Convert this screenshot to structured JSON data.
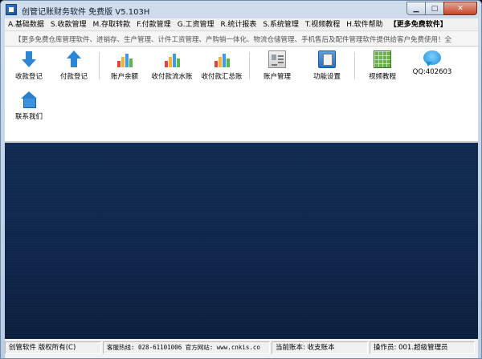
{
  "window": {
    "title": "创管记账财务软件 免费版  V5.103H"
  },
  "window_buttons": {
    "minimize": "▁",
    "maximize": "□",
    "close": "✕"
  },
  "menu": [
    {
      "label": "A.基础数据"
    },
    {
      "label": "S.收款管理"
    },
    {
      "label": "M.存取转款"
    },
    {
      "label": "F.付款管理"
    },
    {
      "label": "G.工资管理"
    },
    {
      "label": "R.统计报表"
    },
    {
      "label": "S.系统管理"
    },
    {
      "label": "T.视频教程"
    },
    {
      "label": "H.软件帮助"
    },
    {
      "label": "【更多免费软件】"
    }
  ],
  "marquee": {
    "text": "【更多免费仓库管理软件、进销存、生产管理、计件工资管理、产购销一体化、物流仓储管理、手机售后及配件管理软件提供给客户免费使用！全"
  },
  "toolbar": {
    "row1": [
      {
        "label": "收款登记",
        "icon": "arrow-down-icon"
      },
      {
        "label": "付款登记",
        "icon": "arrow-up-icon"
      },
      {
        "label": "账户余额",
        "icon": "bar-chart-icon"
      },
      {
        "label": "收付款流水账",
        "icon": "bar-chart-icon"
      },
      {
        "label": "收付款汇总账",
        "icon": "bar-chart-icon"
      },
      {
        "label": "账户管理",
        "icon": "account-doc-icon"
      },
      {
        "label": "功能设置",
        "icon": "settings-doc-icon"
      },
      {
        "label": "视频教程",
        "icon": "spreadsheet-icon"
      },
      {
        "label": "QQ:402603",
        "icon": "chat-bubble-icon"
      }
    ],
    "row2": [
      {
        "label": "联系我们",
        "icon": "home-icon"
      }
    ]
  },
  "colors": {
    "accent": "#2b86d6",
    "workspace": "#112a52",
    "close_button": "#c6452b"
  },
  "statusbar": {
    "copyright": "创管软件  版权所有(C)",
    "hotline": "客服热线: 028-61101006  官方网站: www.cnkis.co",
    "current_account": "当前账本: 收支账本",
    "operator": "操作员: 001.超级管理员"
  }
}
